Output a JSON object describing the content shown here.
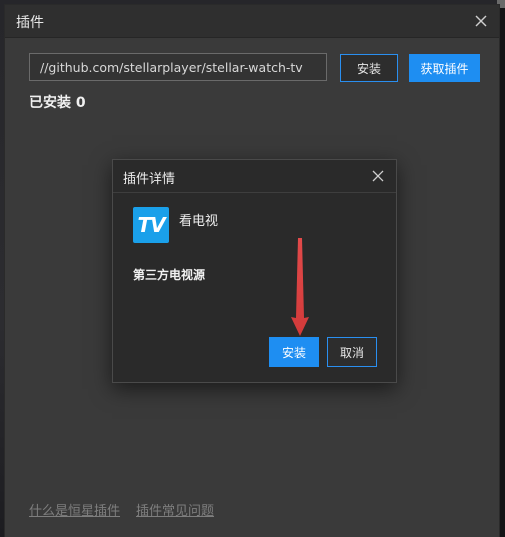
{
  "window": {
    "title": "插件",
    "close_icon": "close-icon"
  },
  "toolbar": {
    "url_value": "//github.com/stellarplayer/stellar-watch-tv",
    "install_label": "安装",
    "get_plugin_label": "获取插件"
  },
  "installed": {
    "label": "已安装 0"
  },
  "footer": {
    "link1": "什么是恒星插件",
    "link2": "插件常见问题"
  },
  "dialog": {
    "title": "插件详情",
    "logo_text": "TV",
    "plugin_name": "看电视",
    "plugin_desc": "第三方电视源",
    "install_label": "安装",
    "cancel_label": "取消"
  },
  "colors": {
    "accent": "#1e8ef2",
    "arrow": "#e24a4a",
    "logo": "#1aa0ea"
  }
}
